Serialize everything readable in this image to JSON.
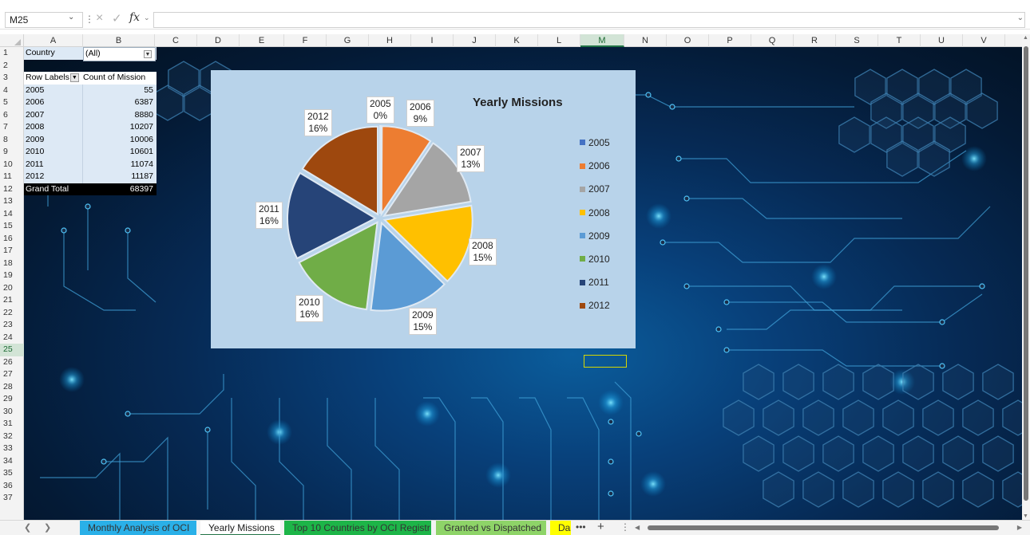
{
  "formula_bar": {
    "name_box": "M25",
    "fx_label": "fx",
    "formula": ""
  },
  "columns": [
    "A",
    "B",
    "C",
    "D",
    "E",
    "F",
    "G",
    "H",
    "I",
    "J",
    "K",
    "L",
    "M",
    "N",
    "O",
    "P",
    "Q",
    "R",
    "S",
    "T",
    "U",
    "V"
  ],
  "active_column": "M",
  "rows": [
    "1",
    "2",
    "3",
    "4",
    "5",
    "6",
    "7",
    "8",
    "9",
    "10",
    "11",
    "12",
    "13",
    "14",
    "15",
    "16",
    "17",
    "18",
    "19",
    "20",
    "21",
    "22",
    "23",
    "24",
    "25",
    "26",
    "27",
    "28",
    "29",
    "30",
    "31",
    "32",
    "33",
    "34",
    "35",
    "36",
    "37"
  ],
  "active_row": "25",
  "pivot": {
    "filter_label": "Country",
    "filter_value": "(All)",
    "row_labels_header": "Row Labels",
    "value_header": "Count of Mission",
    "rows": [
      {
        "label": "2005",
        "value": "55"
      },
      {
        "label": "2006",
        "value": "6387"
      },
      {
        "label": "2007",
        "value": "8880"
      },
      {
        "label": "2008",
        "value": "10207"
      },
      {
        "label": "2009",
        "value": "10006"
      },
      {
        "label": "2010",
        "value": "10601"
      },
      {
        "label": "2011",
        "value": "11074"
      },
      {
        "label": "2012",
        "value": "11187"
      }
    ],
    "grand_total_label": "Grand Total",
    "grand_total_value": "68397"
  },
  "chart_data": {
    "type": "pie",
    "title": "Yearly Missions",
    "categories": [
      "2005",
      "2006",
      "2007",
      "2008",
      "2009",
      "2010",
      "2011",
      "2012"
    ],
    "values": [
      55,
      6387,
      8880,
      10207,
      10006,
      10601,
      11074,
      11187
    ],
    "percent_labels": [
      "0%",
      "9%",
      "13%",
      "15%",
      "15%",
      "16%",
      "16%",
      "16%"
    ],
    "colors": [
      "#4472c4",
      "#ed7d31",
      "#a5a5a5",
      "#ffc000",
      "#5b9bd5",
      "#70ad47",
      "#264478",
      "#9e480e"
    ],
    "legend_position": "right"
  },
  "sheet_tabs": [
    {
      "label": "Monthly Analysis of OCI",
      "color": "#2ab0e8"
    },
    {
      "label": "Yearly Missions",
      "color": "#ffffff"
    },
    {
      "label": "Top 10 Countries by OCI Registr",
      "color": "#1db548"
    },
    {
      "label": "Granted vs Dispatched",
      "color": "#8ed468"
    },
    {
      "label": "Das",
      "color": "#ffff00"
    }
  ],
  "tab_bar": {
    "more": "•••",
    "add": "+",
    "split": "⋮"
  }
}
